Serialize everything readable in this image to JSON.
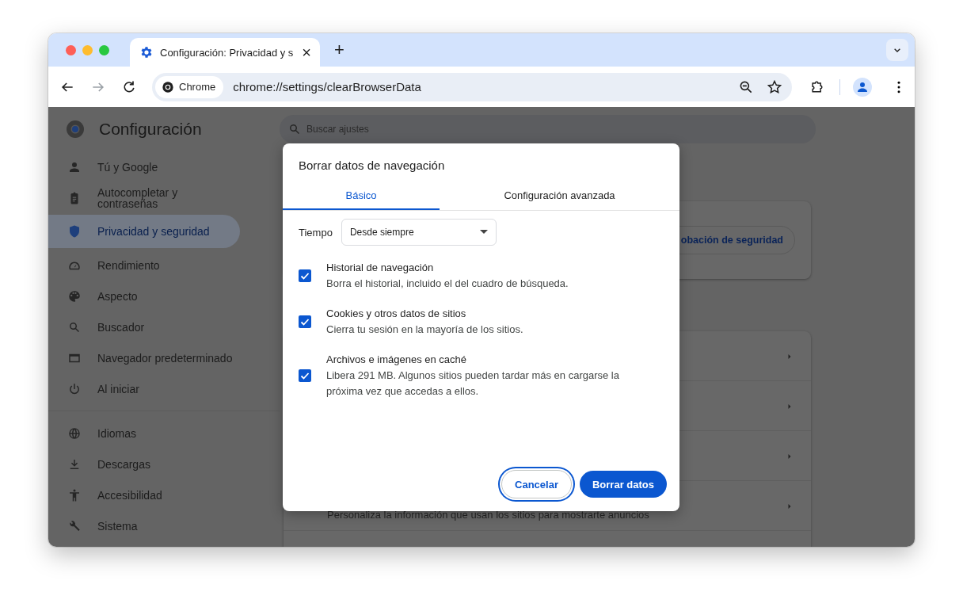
{
  "tab": {
    "title": "Configuración: Privacidad y s",
    "close": "×"
  },
  "new_tab": "+",
  "nav_buttons": [
    {
      "disabled": false
    },
    {
      "disabled": true
    },
    {
      "disabled": false
    }
  ],
  "omnibox": {
    "chip": "Chrome",
    "url": "chrome://settings/clearBrowserData"
  },
  "settings": {
    "title": "Configuración",
    "sections": [
      {
        "items": [
          {
            "label": "Tú y Google",
            "selected": false
          },
          {
            "label": "Autocompletar y contraseñas",
            "selected": false
          },
          {
            "label": "Privacidad y seguridad",
            "selected": true
          },
          {
            "label": "Rendimiento",
            "selected": false
          },
          {
            "label": "Aspecto",
            "selected": false
          },
          {
            "label": "Buscador",
            "selected": false
          },
          {
            "label": "Navegador predeterminado",
            "selected": false
          },
          {
            "label": "Al iniciar",
            "selected": false
          }
        ]
      },
      {
        "items": [
          {
            "label": "Idiomas",
            "selected": false
          },
          {
            "label": "Descargas",
            "selected": false
          },
          {
            "label": "Accesibilidad",
            "selected": false
          },
          {
            "label": "Sistema",
            "selected": false
          }
        ]
      }
    ],
    "search": {
      "placeholder": "Buscar ajustes"
    },
    "safety_button": "obación de seguridad",
    "rows": [
      {
        "kind": "arrow"
      },
      {
        "kind": "arrow"
      },
      {
        "kind": "arrow"
      },
      {
        "kind": "arrow",
        "description": "Personaliza la información que usan los sitios para mostrarte anuncios"
      }
    ]
  },
  "dialog": {
    "title": "Borrar datos de navegación",
    "tabs": [
      {
        "label": "Básico",
        "selected": true
      },
      {
        "label": "Configuración avanzada",
        "selected": false
      }
    ],
    "time": {
      "label": "Tiempo",
      "value": "Desde siempre"
    },
    "options": [
      {
        "title": "Historial de navegación",
        "description": "Borra el historial, incluido el del cuadro de búsqueda.",
        "checked": true
      },
      {
        "title": "Cookies y otros datos de sitios",
        "description": "Cierra tu sesión en la mayoría de los sitios.",
        "checked": true
      },
      {
        "title": "Archivos e imágenes en caché",
        "description": "Libera 291 MB. Algunos sitios pueden tardar más en cargarse la próxima vez que accedas a ellos.",
        "checked": true
      }
    ],
    "buttons": [
      {
        "label": "Cancelar",
        "kind": "secondary"
      },
      {
        "label": "Borrar datos",
        "kind": "primary"
      }
    ]
  }
}
